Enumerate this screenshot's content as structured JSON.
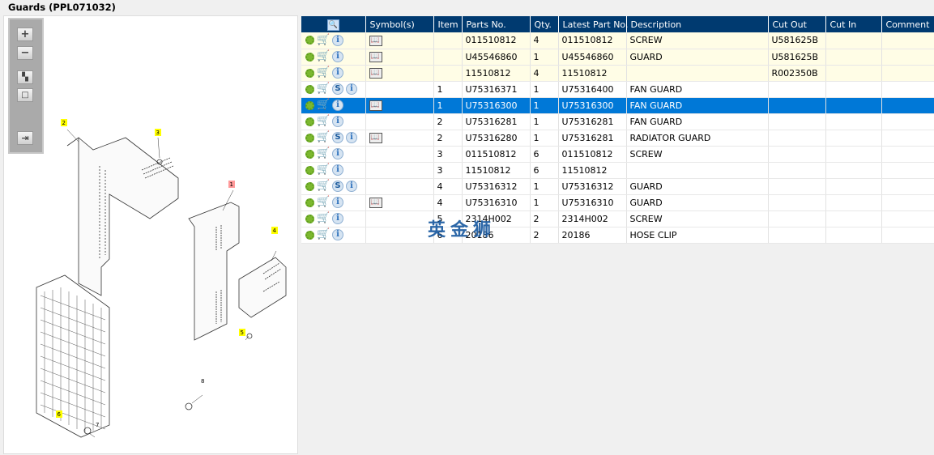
{
  "title": "Guards (PPL071032)",
  "toolbar": {
    "zoom_in": "zoom-in",
    "zoom_out": "zoom-out",
    "fit": "fit",
    "actual": "actual-size",
    "export": "export"
  },
  "diagram": {
    "callouts": [
      "1",
      "2",
      "3",
      "4",
      "5",
      "6",
      "7",
      "8"
    ]
  },
  "watermark": "英金狮",
  "grid": {
    "columns": [
      "",
      "Symbol(s)",
      "Item",
      "Parts No.",
      "Qty.",
      "Latest Part No.",
      "Description",
      "Cut Out",
      "Cut In",
      "Comment"
    ],
    "rows": [
      {
        "style": "y",
        "s": false,
        "book": true,
        "item": "",
        "part": "011510812",
        "qty": "4",
        "latest": "011510812",
        "desc": "SCREW",
        "cutout": "U581625B",
        "cutin": "",
        "comment": ""
      },
      {
        "style": "y",
        "s": false,
        "book": true,
        "item": "",
        "part": "U45546860",
        "qty": "1",
        "latest": "U45546860",
        "desc": "GUARD",
        "cutout": "U581625B",
        "cutin": "",
        "comment": ""
      },
      {
        "style": "y",
        "s": false,
        "book": true,
        "item": "",
        "part": "11510812",
        "qty": "4",
        "latest": "11510812",
        "desc": "",
        "cutout": "R002350B",
        "cutin": "",
        "comment": ""
      },
      {
        "style": "",
        "s": true,
        "book": false,
        "item": "1",
        "part": "U75316371",
        "qty": "1",
        "latest": "U75316400",
        "desc": "FAN GUARD",
        "cutout": "",
        "cutin": "",
        "comment": ""
      },
      {
        "style": "sel",
        "s": false,
        "book": true,
        "item": "1",
        "part": "U75316300",
        "qty": "1",
        "latest": "U75316300",
        "desc": "FAN GUARD",
        "cutout": "",
        "cutin": "",
        "comment": ""
      },
      {
        "style": "",
        "s": false,
        "book": false,
        "item": "2",
        "part": "U75316281",
        "qty": "1",
        "latest": "U75316281",
        "desc": "FAN GUARD",
        "cutout": "",
        "cutin": "",
        "comment": ""
      },
      {
        "style": "",
        "s": true,
        "book": true,
        "item": "2",
        "part": "U75316280",
        "qty": "1",
        "latest": "U75316281",
        "desc": "RADIATOR GUARD",
        "cutout": "",
        "cutin": "",
        "comment": ""
      },
      {
        "style": "",
        "s": false,
        "book": false,
        "item": "3",
        "part": "011510812",
        "qty": "6",
        "latest": "011510812",
        "desc": "SCREW",
        "cutout": "",
        "cutin": "",
        "comment": ""
      },
      {
        "style": "",
        "s": false,
        "book": false,
        "item": "3",
        "part": "11510812",
        "qty": "6",
        "latest": "11510812",
        "desc": "",
        "cutout": "",
        "cutin": "",
        "comment": ""
      },
      {
        "style": "",
        "s": true,
        "book": false,
        "item": "4",
        "part": "U75316312",
        "qty": "1",
        "latest": "U75316312",
        "desc": "GUARD",
        "cutout": "",
        "cutin": "",
        "comment": ""
      },
      {
        "style": "",
        "s": false,
        "book": true,
        "item": "4",
        "part": "U75316310",
        "qty": "1",
        "latest": "U75316310",
        "desc": "GUARD",
        "cutout": "",
        "cutin": "",
        "comment": ""
      },
      {
        "style": "",
        "s": false,
        "book": false,
        "item": "5",
        "part": "2314H002",
        "qty": "2",
        "latest": "2314H002",
        "desc": "SCREW",
        "cutout": "",
        "cutin": "",
        "comment": ""
      },
      {
        "style": "",
        "s": false,
        "book": false,
        "item": "6",
        "part": "20186",
        "qty": "2",
        "latest": "20186",
        "desc": "HOSE CLIP",
        "cutout": "",
        "cutin": "",
        "comment": ""
      }
    ]
  }
}
